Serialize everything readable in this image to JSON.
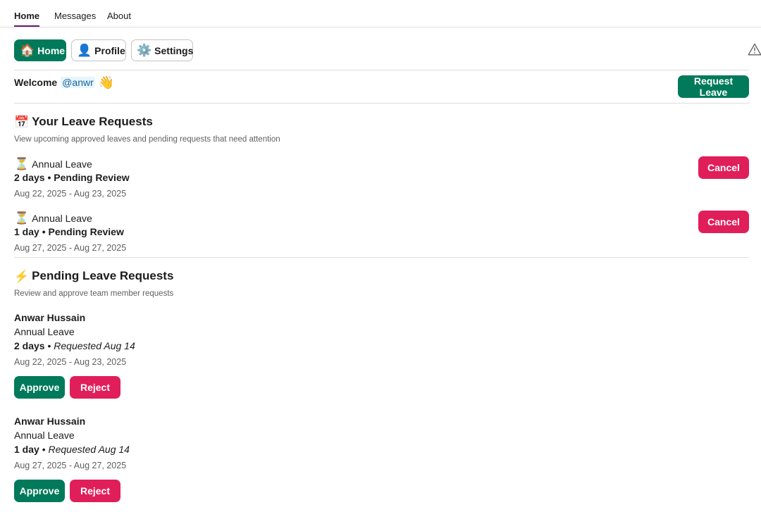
{
  "tabs": [
    "Home",
    "Messages",
    "About"
  ],
  "nav": {
    "home": {
      "icon": "🏠",
      "label": "Home"
    },
    "profile": {
      "icon": "👤",
      "label": "Profile"
    },
    "settings": {
      "icon": "⚙️",
      "label": "Settings"
    }
  },
  "welcome": {
    "text": "Welcome",
    "mention": "@anwr",
    "emoji": "👋"
  },
  "request_leave_label": "Request Leave",
  "your_requests": {
    "icon": "📅",
    "title": "Your Leave Requests",
    "subtitle": "View upcoming approved leaves and pending requests that need attention",
    "items": [
      {
        "icon": "⏳",
        "type": "Annual Leave",
        "summary": "2 days • Pending Review",
        "dates": "Aug 22, 2025 - Aug 23, 2025",
        "action": "Cancel"
      },
      {
        "icon": "⏳",
        "type": "Annual Leave",
        "summary": "1 day • Pending Review",
        "dates": "Aug 27, 2025 - Aug 27, 2025",
        "action": "Cancel"
      }
    ]
  },
  "pending_requests": {
    "icon": "⚡",
    "title": "Pending Leave Requests",
    "subtitle": "Review and approve team member requests",
    "items": [
      {
        "name": "Anwar Hussain",
        "type": "Annual Leave",
        "days": "2 days",
        "bullet": "•",
        "requested": "Requested Aug 14",
        "dates": "Aug 22, 2025 - Aug 23, 2025",
        "approve": "Approve",
        "reject": "Reject"
      },
      {
        "name": "Anwar Hussain",
        "type": "Annual Leave",
        "days": "1 day",
        "bullet": "•",
        "requested": "Requested Aug 14",
        "dates": "Aug 27, 2025 - Aug 27, 2025",
        "approve": "Approve",
        "reject": "Reject"
      }
    ]
  },
  "icons": {
    "warning": "warning-icon"
  },
  "colors": {
    "green": "#007a5a",
    "red": "#e01e5a",
    "tab_underline": "#611f69",
    "mention": "#1264a3"
  }
}
